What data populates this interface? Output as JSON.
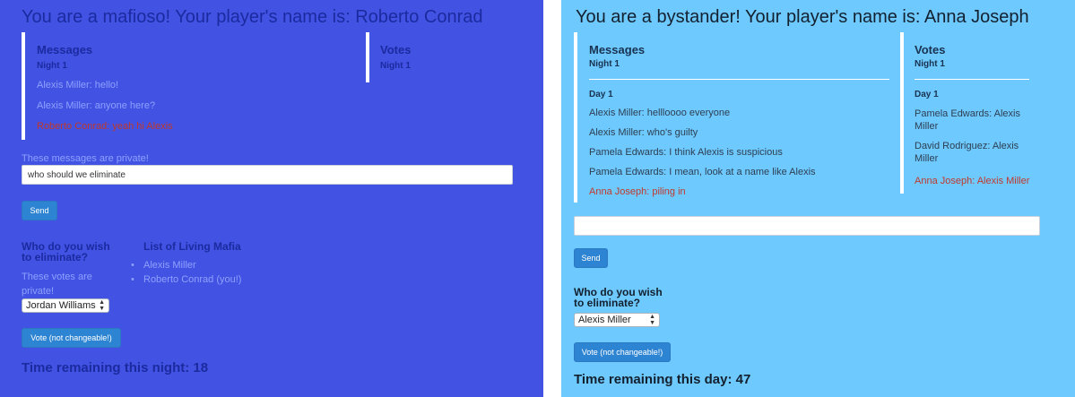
{
  "left": {
    "title": "You are a mafioso! Your player's name is: Roberto Conrad",
    "messages": {
      "heading": "Messages",
      "night_label": "Night 1",
      "items": [
        {
          "text": "Alexis Miller: hello!",
          "self": false
        },
        {
          "text": "Alexis Miller: anyone here?",
          "self": false
        },
        {
          "text": "Roberto Conrad: yeah hi Alexis",
          "self": true
        }
      ]
    },
    "votes": {
      "heading": "Votes",
      "night_label": "Night 1"
    },
    "private_note": "These messages are private!",
    "input_value": "who should we eliminate",
    "send_label": "Send",
    "eliminate_heading_line1": "Who do you wish",
    "eliminate_heading_line2": "to eliminate?",
    "votes_private_line1": "These votes are",
    "votes_private_line2": "private!",
    "vote_select_value": "Jordan Williams",
    "mafia_heading": "List of Living Mafia",
    "mafia_list": [
      "Alexis Miller",
      "Roberto Conrad (you!)"
    ],
    "vote_button_label": "Vote (not changeable!)",
    "timer": "Time remaining this night: 18"
  },
  "right": {
    "title": "You are a bystander! Your player's name is: Anna Joseph",
    "messages": {
      "heading": "Messages",
      "night_label": "Night 1",
      "day_label": "Day 1",
      "items": [
        {
          "text": "Alexis Miller: hellloooo everyone",
          "self": false
        },
        {
          "text": "Alexis Miller: who's guilty",
          "self": false
        },
        {
          "text": "Pamela Edwards: I think Alexis is suspicious",
          "self": false
        },
        {
          "text": "Pamela Edwards: I mean, look at a name like Alexis",
          "self": false
        },
        {
          "text": "Anna Joseph: piling in",
          "self": true
        }
      ]
    },
    "votes": {
      "heading": "Votes",
      "night_label": "Night 1",
      "day_label": "Day 1",
      "items": [
        {
          "line1": "Pamela Edwards: Alexis",
          "line2": "Miller",
          "self": false
        },
        {
          "line1": "David Rodriguez: Alexis",
          "line2": "Miller",
          "self": false
        },
        {
          "line1": "Anna Joseph: Alexis Miller",
          "line2": "",
          "self": true
        }
      ]
    },
    "input_value": "",
    "send_label": "Send",
    "eliminate_heading_line1": "Who do you wish",
    "eliminate_heading_line2": "to eliminate?",
    "vote_select_value": "Alexis Miller",
    "vote_button_label": "Vote (not changeable!)",
    "timer": "Time remaining this day: 47"
  },
  "colors": {
    "mafia_bg": "#4253e3",
    "bystander_bg": "#6ec9ff",
    "own_message": "#c0392b",
    "button": "#2d84d2"
  }
}
